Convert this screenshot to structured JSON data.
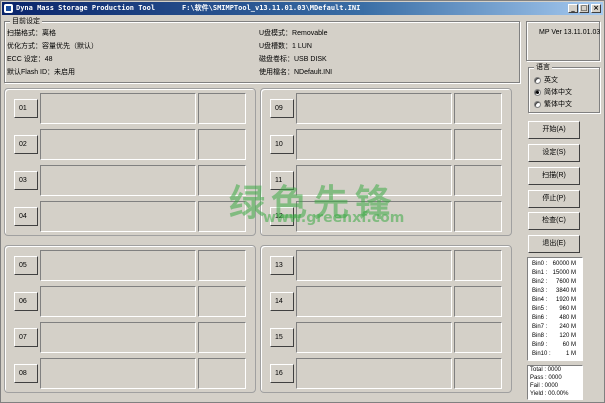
{
  "window": {
    "app_title": "Dyna Mass Storage Production Tool",
    "path": "F:\\软件\\SMIMPTool_v13.11.01.03\\MDefault.INI",
    "min_label": "_",
    "max_label": "□",
    "close_label": "×"
  },
  "settings": {
    "group_title": "目前设定",
    "left": [
      {
        "label": "扫描格式：离格"
      },
      {
        "label": "优化方式：容量优先（默认）"
      },
      {
        "label": "ECC 设定：48"
      },
      {
        "label": "默认Flash ID：未启用"
      }
    ],
    "right": [
      {
        "label": "U盘模式：Removable"
      },
      {
        "label": "U盘槽数：1 LUN"
      },
      {
        "label": "磁盘卷标：USB DISK"
      },
      {
        "label": "使用檔名：NDefault.INI"
      }
    ]
  },
  "version": "MP Ver 13.11.01.03",
  "language": {
    "title": "语言",
    "options": [
      {
        "label": "英文",
        "selected": false
      },
      {
        "label": "简体中文",
        "selected": true
      },
      {
        "label": "繁体中文",
        "selected": false
      }
    ]
  },
  "ports": {
    "group1": [
      "01",
      "02",
      "03",
      "04"
    ],
    "group2": [
      "09",
      "10",
      "11",
      "12"
    ],
    "group3": [
      "05",
      "06",
      "07",
      "08"
    ],
    "group4": [
      "13",
      "14",
      "15",
      "16"
    ]
  },
  "buttons": {
    "start": "开始(A)",
    "settings": "设定(S)",
    "scan": "扫描(R)",
    "stop": "停止(P)",
    "check": "检查(C)",
    "exit": "退出(E)"
  },
  "bins": [
    {
      "name": "Bin0 :",
      "value": "60000 M"
    },
    {
      "name": "Bin1 :",
      "value": "15000 M"
    },
    {
      "name": "Bin2 :",
      "value": "7600 M"
    },
    {
      "name": "Bin3 :",
      "value": "3840 M"
    },
    {
      "name": "Bin4 :",
      "value": "1920 M"
    },
    {
      "name": "Bin5 :",
      "value": "960 M"
    },
    {
      "name": "Bin6 :",
      "value": "480 M"
    },
    {
      "name": "Bin7 :",
      "value": "240 M"
    },
    {
      "name": "Bin8 :",
      "value": "120 M"
    },
    {
      "name": "Bin9 :",
      "value": "60 M"
    },
    {
      "name": "Bin10 :",
      "value": "1 M"
    }
  ],
  "stats": {
    "total": "Total : 0000",
    "pass": "Pass : 0000",
    "fail": "Fail : 0000",
    "yield": "Yield : 00.00%"
  },
  "watermark": {
    "main": "绿色先锋",
    "url": "www.greenxf.com"
  }
}
